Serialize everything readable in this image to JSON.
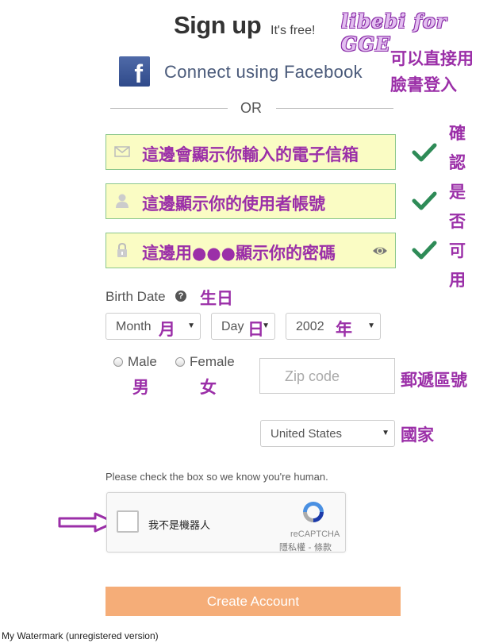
{
  "header": {
    "title": "Sign up",
    "subtitle": "It's free!",
    "brand_mark": "libebi for GGE"
  },
  "facebook": {
    "button_label": "Connect using Facebook",
    "logo_letter": "f",
    "annotation_line1": "可以直接用",
    "annotation_line2": "臉書登入"
  },
  "divider": {
    "label": "OR"
  },
  "fields": {
    "email": {
      "value": "這邊會顯示你輸入的電子信箱",
      "icon": "envelope-icon"
    },
    "username": {
      "value": "這邊顯示你的使用者帳號",
      "icon": "user-icon"
    },
    "password": {
      "value": "這邊用●●●顯示你的密碼",
      "icon": "lock-icon",
      "toggle_icon": "eye-icon"
    },
    "valid_icon": "checkmark-icon",
    "validation_note": [
      "確",
      "認",
      "是",
      "否",
      "可",
      "用"
    ]
  },
  "birth": {
    "label": "Birth Date",
    "help_glyph": "?",
    "annotation": "生日",
    "month": {
      "value": "Month",
      "annotation": "月"
    },
    "day": {
      "value": "Day",
      "annotation": "日"
    },
    "year": {
      "value": "2002",
      "annotation": "年"
    }
  },
  "gender": {
    "male_label": "Male",
    "male_annotation": "男",
    "female_label": "Female",
    "female_annotation": "女"
  },
  "zip": {
    "placeholder": "Zip code",
    "annotation": "郵遞區號"
  },
  "country": {
    "value": "United States",
    "annotation": "國家"
  },
  "captcha": {
    "prompt": "Please check the box so we know you're human.",
    "checkbox_label": "我不是機器人",
    "brand": "reCAPTCHA",
    "terms": "隱私權 - 條款"
  },
  "submit": {
    "label": "Create Account"
  },
  "watermark": "My Watermark (unregistered version)",
  "colors": {
    "annotation": "#9b2fa8",
    "field_bg": "#fafcc4",
    "field_border": "#8bc78b",
    "check_green": "#2e8b57",
    "facebook_blue": "#3b5998",
    "button_orange": "#f5ad78"
  }
}
